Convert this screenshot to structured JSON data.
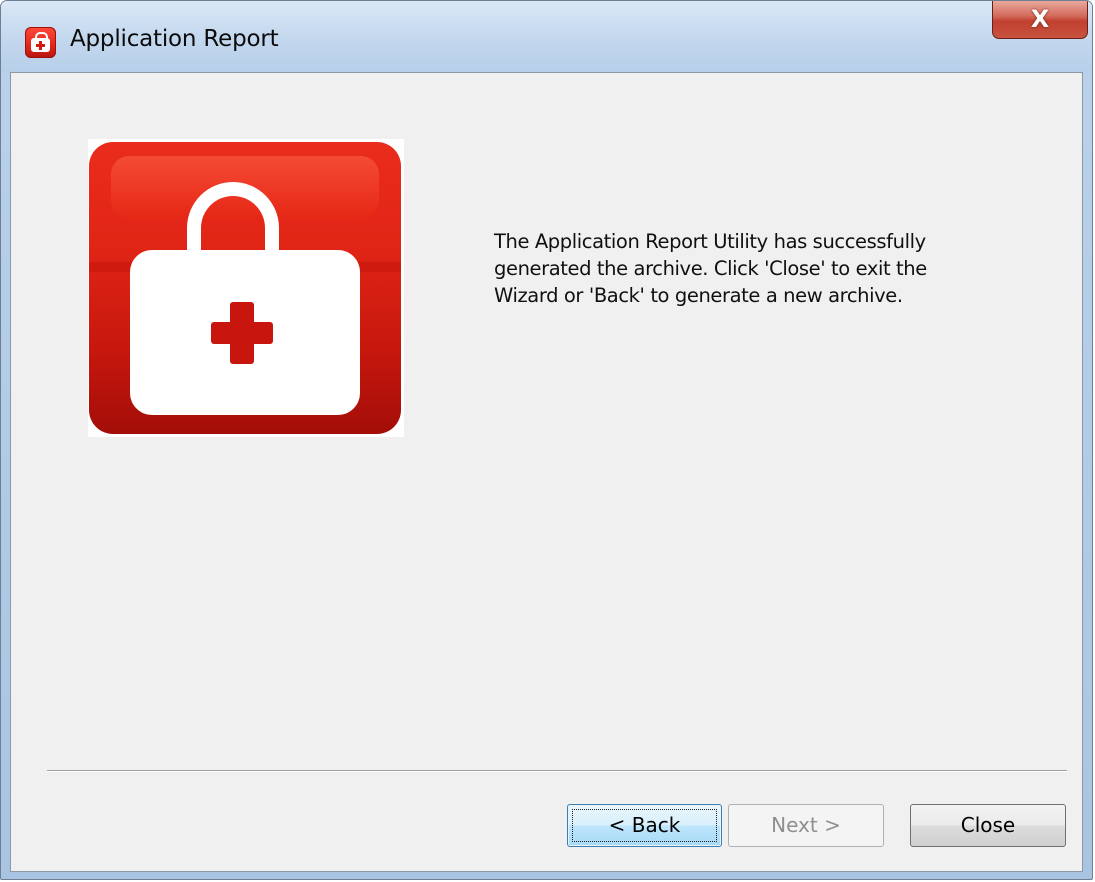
{
  "window": {
    "title": "Application Report",
    "close_glyph": "X",
    "icon": "first-aid-kit-icon"
  },
  "main": {
    "hero_icon": "first-aid-kit-icon",
    "message": "The Application Report Utility has successfully\ngenerated the archive. Click 'Close' to exit the\nWizard or 'Back' to generate a new archive."
  },
  "buttons": {
    "back_label": "< Back",
    "next_label": "Next >",
    "close_label": "Close"
  },
  "colors": {
    "accent_red": "#e12516",
    "dialog_bg": "#f0f0f0",
    "default_button_border": "#3c7fb1"
  }
}
